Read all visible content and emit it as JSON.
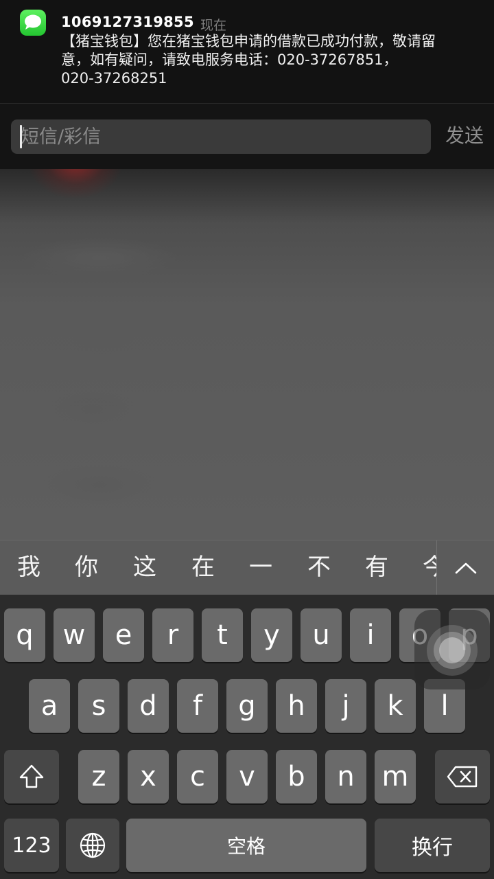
{
  "notification": {
    "sender": "1069127319855",
    "time": "现在",
    "lines": [
      "【猪宝钱包】您在猪宝钱包申请的借款已成功付款，敬请留",
      "意，如有疑问，请致电服务电话：020-37267851，",
      "020-37268251"
    ],
    "app_icon": "messages-icon"
  },
  "reply": {
    "placeholder": "短信/彩信",
    "send_label": "发送"
  },
  "candidates": [
    "我",
    "你",
    "这",
    "在",
    "一",
    "不",
    "有",
    "今"
  ],
  "keyboard": {
    "row1": [
      "q",
      "w",
      "e",
      "r",
      "t",
      "y",
      "u",
      "i",
      "o",
      "p"
    ],
    "row2": [
      "a",
      "s",
      "d",
      "f",
      "g",
      "h",
      "j",
      "k",
      "l"
    ],
    "row3": [
      "z",
      "x",
      "c",
      "v",
      "b",
      "n",
      "m"
    ],
    "numbers_label": "123",
    "space_label": "空格",
    "return_label": "换行",
    "globe_icon": "globe-icon",
    "shift_icon": "shift-icon",
    "delete_icon": "delete-icon"
  },
  "colors": {
    "messages_green": "#4cd964",
    "keyboard_bg": "#2b2b2b",
    "key_bg": "#6a6a6a",
    "func_key_bg": "#474747"
  }
}
